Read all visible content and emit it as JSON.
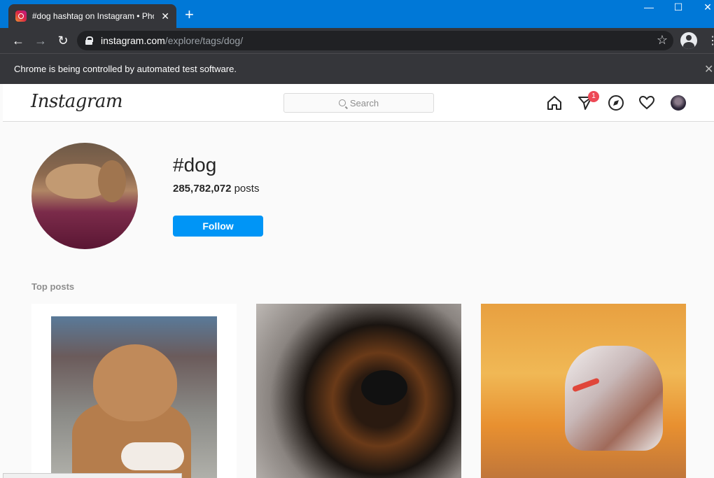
{
  "browser": {
    "tab_title": "#dog hashtag on Instagram • Photos and videos",
    "url_host": "instagram.com",
    "url_path": "/explore/tags/dog/",
    "infobar_text": "Chrome is being controlled by automated test software."
  },
  "header": {
    "logo": "Instagram",
    "search_placeholder": "Search",
    "direct_badge": "1"
  },
  "hashtag": {
    "name": "#dog",
    "post_count": "285,782,072",
    "post_count_suffix": " posts",
    "follow_label": "Follow"
  },
  "sections": {
    "top_posts_label": "Top posts"
  },
  "colors": {
    "follow_blue": "#0095f6",
    "badge_red": "#ed4956",
    "chrome_blue": "#0078d7"
  }
}
